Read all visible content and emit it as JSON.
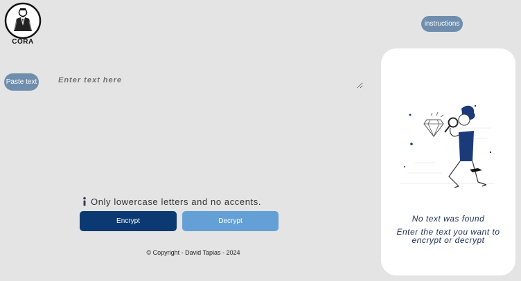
{
  "header": {
    "logo_text": "CORA",
    "instructions_label": "instructions"
  },
  "input": {
    "paste_label": "Paste text",
    "placeholder": "Enter text here",
    "hint": "Only lowercase letters and no accents."
  },
  "actions": {
    "encrypt_label": "Encrypt",
    "decrypt_label": "Decrypt"
  },
  "footer": {
    "copyright": "© Copyright - David Tapias - 2024"
  },
  "result": {
    "empty_title": "No text was found",
    "empty_subtitle": "Enter the text you want to encrypt or decrypt"
  },
  "colors": {
    "background": "#e4e4e4",
    "pill_button": "#6f8ead",
    "encrypt": "#0b3a72",
    "decrypt": "#64a0d6",
    "panel": "#ffffff",
    "panel_text": "#20345a"
  },
  "icons": [
    "logo-person-icon",
    "info-icon",
    "detective-illustration"
  ]
}
